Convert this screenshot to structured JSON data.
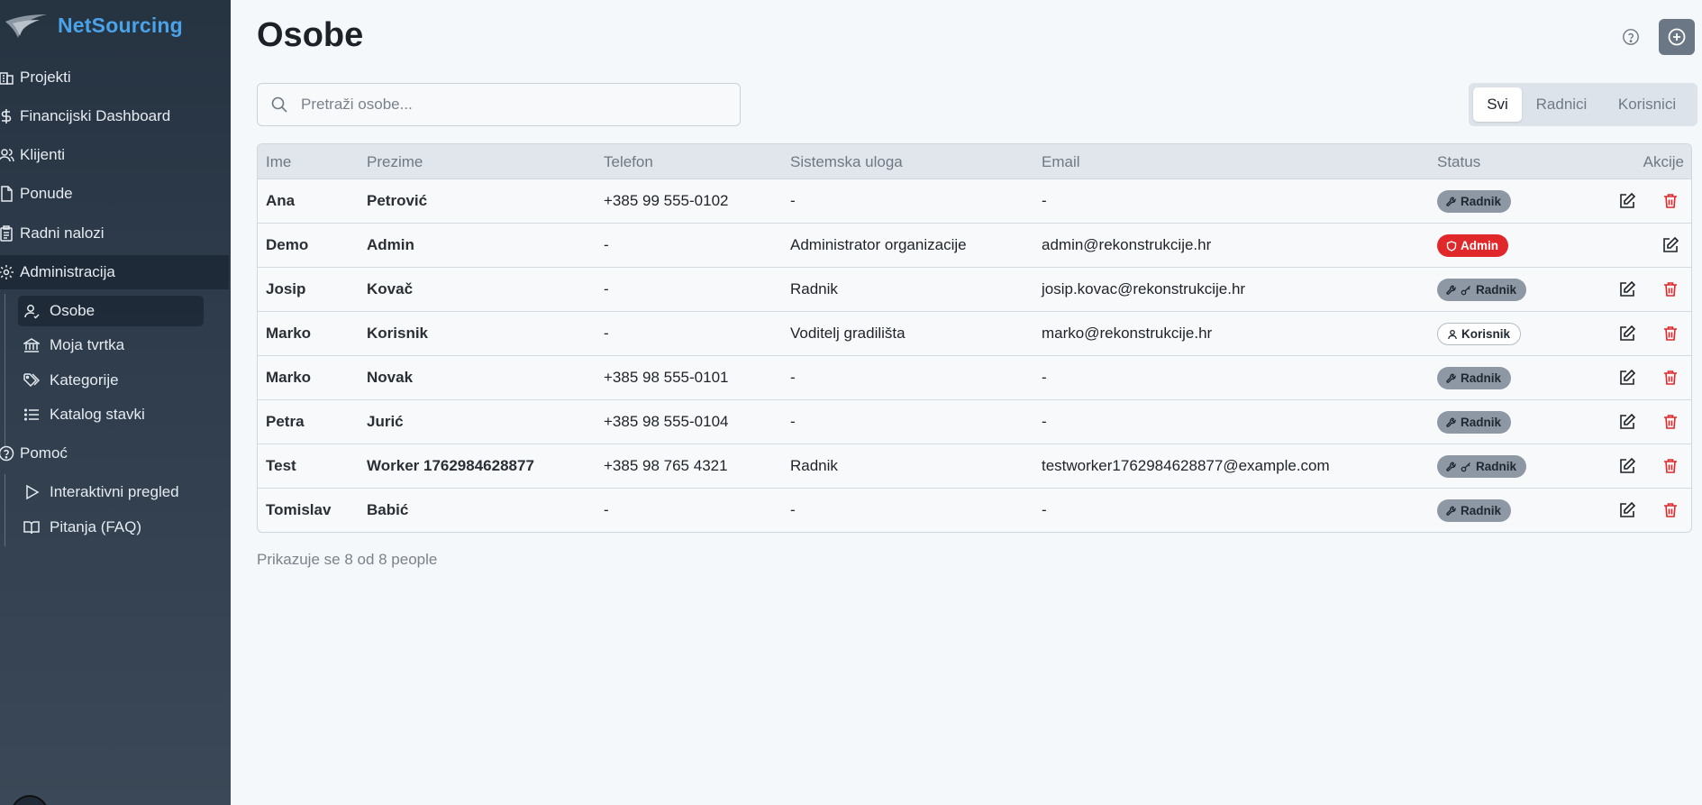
{
  "app": {
    "name": "NetSourcing"
  },
  "sidebar": {
    "items": [
      {
        "label": "Projekti",
        "icon": "building-icon"
      },
      {
        "label": "Financijski Dashboard",
        "icon": "dollar-icon"
      },
      {
        "label": "Klijenti",
        "icon": "users-icon"
      },
      {
        "label": "Ponude",
        "icon": "file-icon"
      },
      {
        "label": "Radni nalozi",
        "icon": "clipboard-icon"
      },
      {
        "label": "Administracija",
        "icon": "gear-icon",
        "active": true
      }
    ],
    "admin_sub": [
      {
        "label": "Osobe",
        "icon": "user-icon",
        "active": true
      },
      {
        "label": "Moja tvrtka",
        "icon": "bank-icon"
      },
      {
        "label": "Kategorije",
        "icon": "tags-icon"
      },
      {
        "label": "Katalog stavki",
        "icon": "list-icon"
      }
    ],
    "help": {
      "label": "Pomoć",
      "icon": "help-circle-icon"
    },
    "help_sub": [
      {
        "label": "Interaktivni pregled",
        "icon": "play-icon"
      },
      {
        "label": "Pitanja (FAQ)",
        "icon": "book-icon"
      }
    ]
  },
  "page": {
    "title": "Osobe",
    "search_placeholder": "Pretraži osobe...",
    "search_value": "",
    "filters": [
      "Svi",
      "Radnici",
      "Korisnici"
    ],
    "selected_filter": "Svi",
    "footer": "Prikazuje se 8 od 8 people"
  },
  "table": {
    "columns": [
      "Ime",
      "Prezime",
      "Telefon",
      "Sistemska uloga",
      "Email",
      "Status",
      "Akcije"
    ],
    "rows": [
      {
        "ime": "Ana",
        "prezime": "Petrović",
        "telefon": "+385 99 555-0102",
        "uloga": "-",
        "email": "-",
        "status": "Radnik",
        "status_type": "radnik",
        "key": false,
        "delete": true
      },
      {
        "ime": "Demo",
        "prezime": "Admin",
        "telefon": "-",
        "uloga": "Administrator organizacije",
        "email": "admin@rekonstrukcije.hr",
        "status": "Admin",
        "status_type": "admin",
        "key": false,
        "delete": false
      },
      {
        "ime": "Josip",
        "prezime": "Kovač",
        "telefon": "-",
        "uloga": "Radnik",
        "email": "josip.kovac@rekonstrukcije.hr",
        "status": "Radnik",
        "status_type": "radnik",
        "key": true,
        "delete": true
      },
      {
        "ime": "Marko",
        "prezime": "Korisnik",
        "telefon": "-",
        "uloga": "Voditelj gradilišta",
        "email": "marko@rekonstrukcije.hr",
        "status": "Korisnik",
        "status_type": "korisnik",
        "key": false,
        "delete": true
      },
      {
        "ime": "Marko",
        "prezime": "Novak",
        "telefon": "+385 98 555-0101",
        "uloga": "-",
        "email": "-",
        "status": "Radnik",
        "status_type": "radnik",
        "key": false,
        "delete": true
      },
      {
        "ime": "Petra",
        "prezime": "Jurić",
        "telefon": "+385 98 555-0104",
        "uloga": "-",
        "email": "-",
        "status": "Radnik",
        "status_type": "radnik",
        "key": false,
        "delete": true
      },
      {
        "ime": "Test",
        "prezime": "Worker 1762984628877",
        "telefon": "+385 98 765 4321",
        "uloga": "Radnik",
        "email": "testworker1762984628877@example.com",
        "status": "Radnik",
        "status_type": "radnik",
        "key": true,
        "delete": true
      },
      {
        "ime": "Tomislav",
        "prezime": "Babić",
        "telefon": "-",
        "uloga": "-",
        "email": "-",
        "status": "Radnik",
        "status_type": "radnik",
        "key": false,
        "delete": true
      }
    ]
  },
  "colors": {
    "brand": "#4aa3e8",
    "sidebar_bg": "#2b3847",
    "admin_badge": "#e0272a",
    "radnik_badge": "#8d98a4",
    "delete_icon": "#e0272a"
  }
}
